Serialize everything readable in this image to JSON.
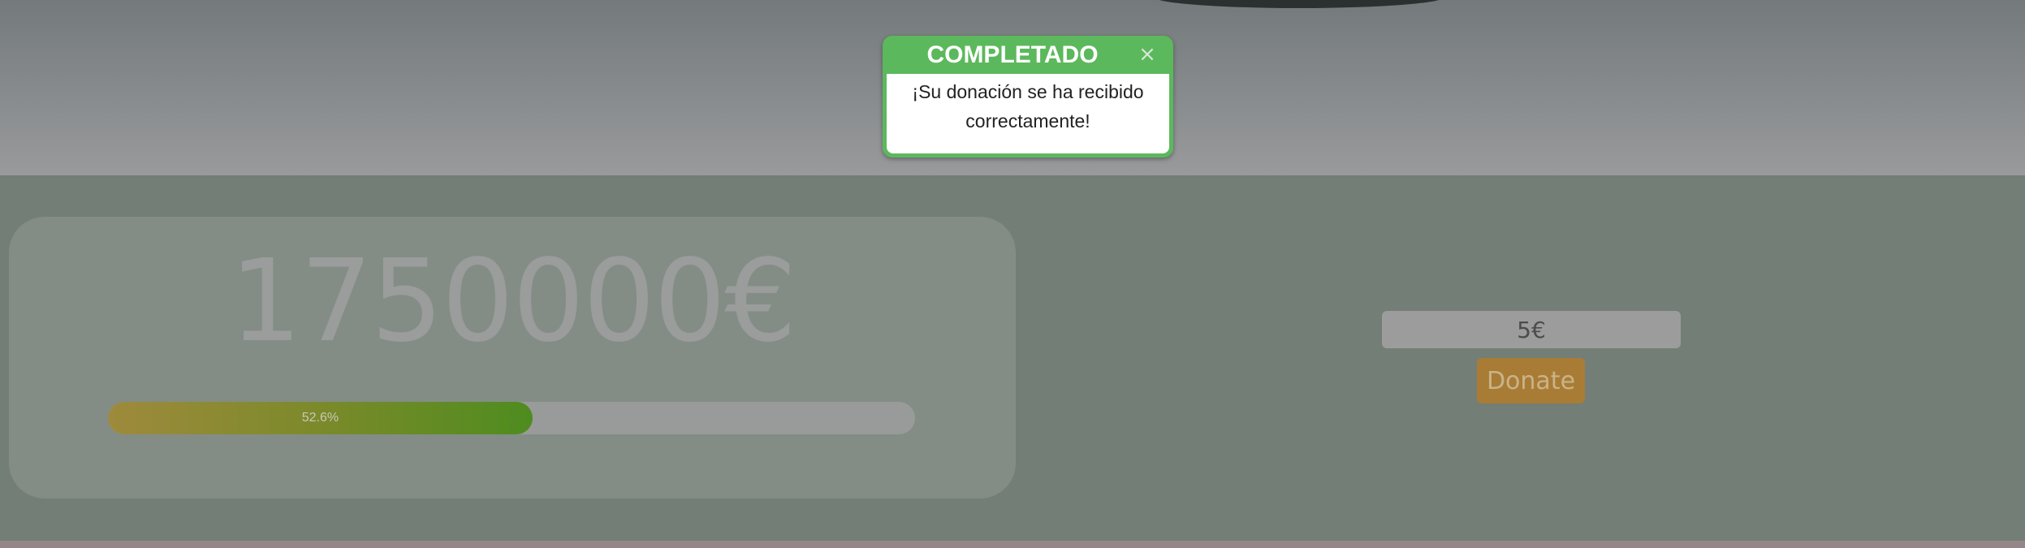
{
  "fundraiser": {
    "goal_amount": "1750000€",
    "progress": {
      "percent": 52.6,
      "label": "52.6%"
    }
  },
  "donate_form": {
    "amount_value": "5€",
    "donate_label": "Donate"
  },
  "notification": {
    "title": "COMPLETADO",
    "close_glyph": "×",
    "message": "¡Su donación se ha recibido correctamente!"
  },
  "colors": {
    "success": "#5cb85c",
    "donate_button": "#a97c35",
    "progress_start": "#9e8a3c",
    "progress_end": "#4e8c1f"
  }
}
